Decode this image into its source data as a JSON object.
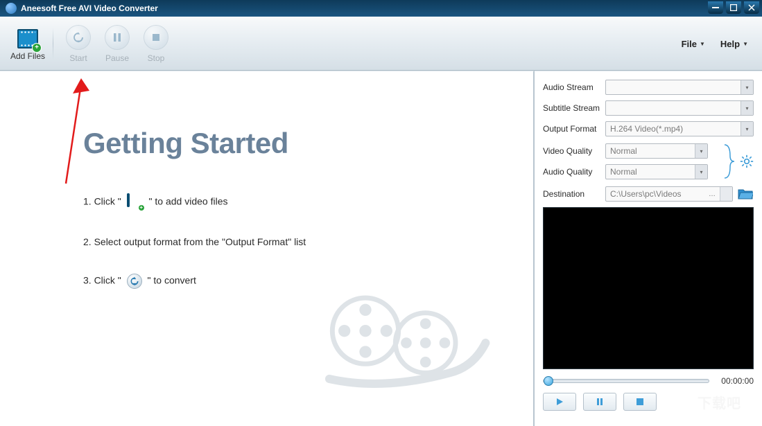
{
  "title": "Aneesoft Free AVI Video Converter",
  "toolbar": {
    "add_files": "Add Files",
    "start": "Start",
    "pause": "Pause",
    "stop": "Stop"
  },
  "menu": {
    "file": "File",
    "help": "Help"
  },
  "getting_started": {
    "heading": "Getting Started",
    "step1a": "1. Click \" ",
    "step1b": " \" to add video files",
    "step2": "2. Select output format from the \"Output Format\" list",
    "step3a": "3. Click \" ",
    "step3b": " \" to convert"
  },
  "settings": {
    "audio_stream_label": "Audio Stream",
    "audio_stream_value": "",
    "subtitle_stream_label": "Subtitle Stream",
    "subtitle_stream_value": "",
    "output_format_label": "Output Format",
    "output_format_value": "H.264 Video(*.mp4)",
    "video_quality_label": "Video Quality",
    "video_quality_value": "Normal",
    "audio_quality_label": "Audio Quality",
    "audio_quality_value": "Normal",
    "destination_label": "Destination",
    "destination_value": "C:\\Users\\pc\\Videos"
  },
  "player": {
    "time": "00:00:00"
  },
  "watermark": "下载吧"
}
